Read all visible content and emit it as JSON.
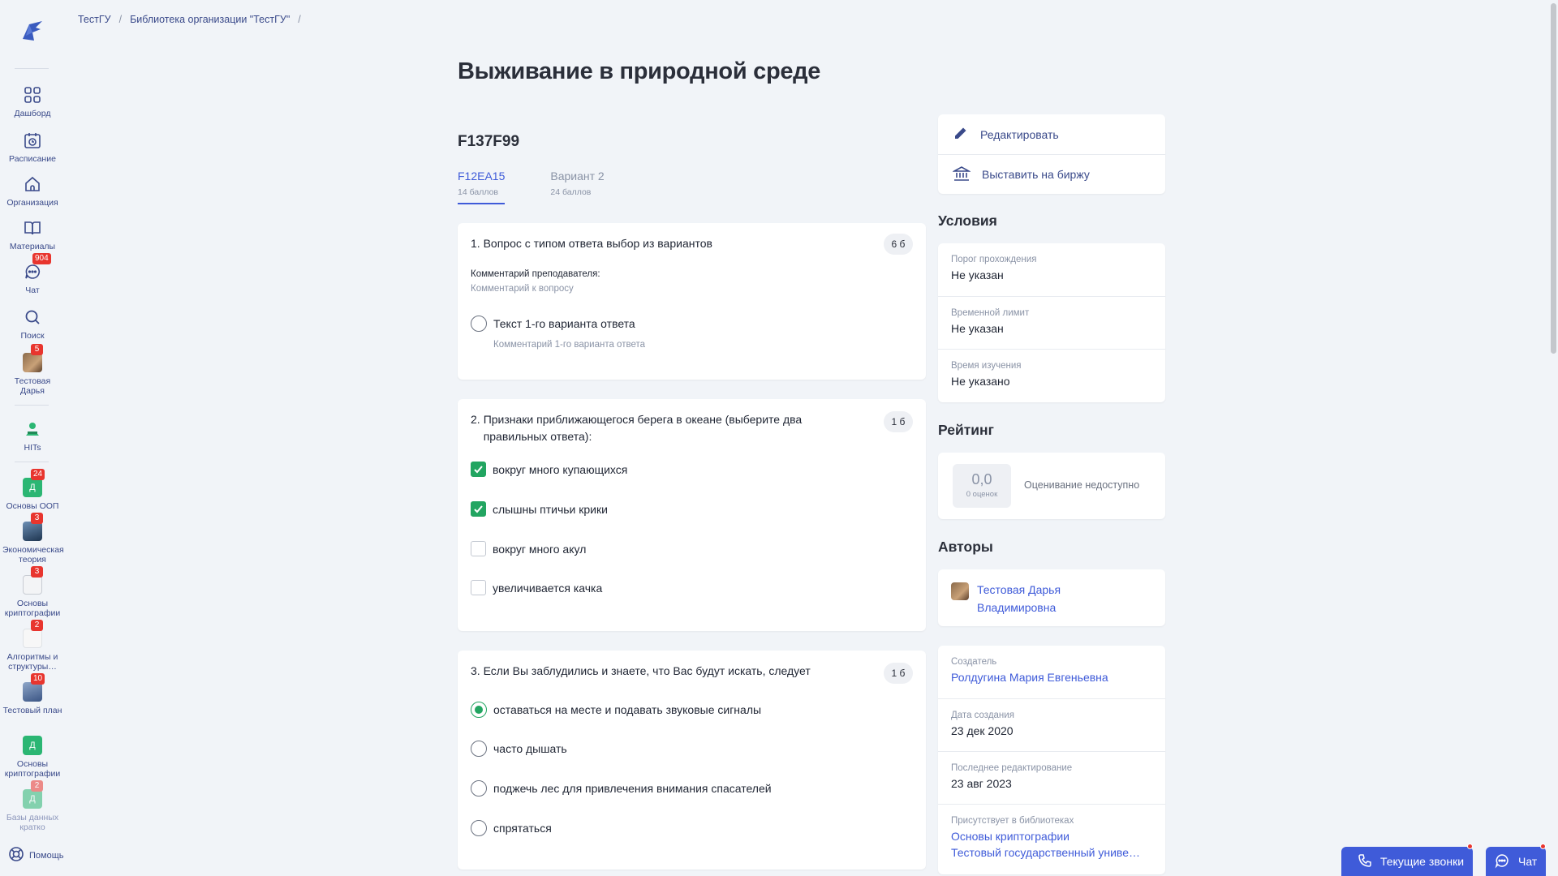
{
  "breadcrumbs": [
    "ТестГУ",
    "Библиотека организации \"ТестГУ\""
  ],
  "breadcrumb_sep": "/",
  "sidebar": {
    "items": [
      {
        "label": "Дашборд",
        "icon": "grid-icon"
      },
      {
        "label": "Расписание",
        "icon": "calendar-icon"
      },
      {
        "label": "Организация",
        "icon": "home-icon"
      },
      {
        "label": "Материалы",
        "icon": "book-icon"
      },
      {
        "label": "Чат",
        "icon": "chat-icon",
        "badge": "904"
      },
      {
        "label": "Поиск",
        "icon": "search-icon"
      },
      {
        "label": "Тестовая Дарья",
        "icon": "avatar-icon",
        "badge": "5"
      },
      {
        "label": "HITs",
        "icon": "hits-icon"
      }
    ],
    "courses": [
      {
        "label": "Основы ООП",
        "letter": "Д",
        "badge": "24",
        "color": "#2bb673"
      },
      {
        "label": "Экономическая теория",
        "badge": "3",
        "color": "#3b5a7a"
      },
      {
        "label": "Основы криптографии",
        "badge": "3",
        "color": "#9aa1ad"
      },
      {
        "label": "Алгоритмы и структуры…",
        "badge": "2",
        "color": "#d0d4db"
      },
      {
        "label": "Тестовый план",
        "badge": "10",
        "color": "#5a76a8"
      },
      {
        "label": "Основы криптографии",
        "letter": "Д",
        "color": "#2bb673"
      },
      {
        "label": "Базы данных кратко",
        "letter": "Д",
        "badge": "2",
        "color": "#2bb673"
      }
    ],
    "help": "Помощь"
  },
  "page": {
    "title": "Выживание в природной среде",
    "test_code": "F137F99",
    "tabs": [
      {
        "name": "F12EA15",
        "sub": "14 баллов",
        "active": true
      },
      {
        "name": "Вариант 2",
        "sub": "24 баллов",
        "active": false
      }
    ]
  },
  "questions": [
    {
      "num": "1.",
      "text": "Вопрос с типом ответа выбор из вариантов",
      "points": "6 б",
      "comment_label": "Комментарий преподавателя:",
      "comment": "Комментарий к вопросу",
      "options": [
        {
          "text": "Текст 1-го варианта ответа",
          "comment": "Комментарий 1-го варианта ответа",
          "checked": false
        }
      ]
    },
    {
      "num": "2.",
      "text": "Признаки приближающегося берега в океане (выберите два правильных ответа):",
      "points": "1 б",
      "options": [
        {
          "text": "вокруг много купающихся",
          "checked": true
        },
        {
          "text": "слышны птичьи крики",
          "checked": true
        },
        {
          "text": "вокруг много акул",
          "checked": false
        },
        {
          "text": "увеличивается качка",
          "checked": false
        }
      ]
    },
    {
      "num": "3.",
      "text": "Если Вы заблудились и знаете, что Вас будут искать, следует",
      "points": "1 б",
      "options": [
        {
          "text": "оставаться на месте и подавать звуковые сигналы",
          "checked": true
        },
        {
          "text": "часто дышать",
          "checked": false
        },
        {
          "text": "поджечь лес для привлечения внимания спасателей",
          "checked": false
        },
        {
          "text": "спрятаться",
          "checked": false
        }
      ]
    }
  ],
  "actions": {
    "edit": "Редактировать",
    "exchange": "Выставить на биржу"
  },
  "conditions": {
    "title": "Условия",
    "rows": [
      {
        "k": "Порог прохождения",
        "v": "Не указан"
      },
      {
        "k": "Временной лимит",
        "v": "Не указан"
      },
      {
        "k": "Время изучения",
        "v": "Не указано"
      }
    ]
  },
  "rating": {
    "title": "Рейтинг",
    "value": "0,0",
    "count": "0 оценок",
    "status": "Оценивание недоступно"
  },
  "authors": {
    "title": "Авторы",
    "name_line1": "Тестовая Дарья",
    "name_line2": "Владимировна"
  },
  "meta": {
    "creator_k": "Создатель",
    "creator_v": "Ролдугина Мария Евгеньевна",
    "created_k": "Дата создания",
    "created_v": "23 дек 2020",
    "edited_k": "Последнее редактирование",
    "edited_v": "23 авг 2023",
    "libs_k": "Присутствует в библиотеках",
    "libs_v1": "Основы криптографии",
    "libs_v2": "Тестовый государственный униве…"
  },
  "floating": {
    "calls": "Текущие звонки",
    "chat": "Чат"
  }
}
